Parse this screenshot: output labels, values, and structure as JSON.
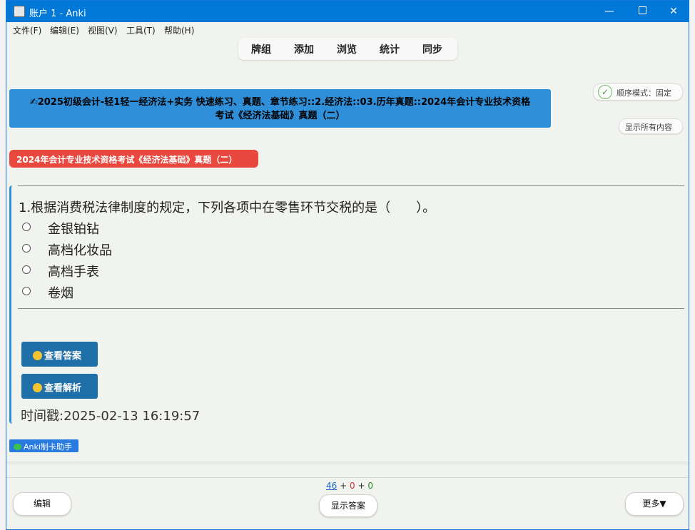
{
  "window": {
    "title": "账户 1 - Anki",
    "controls": [
      "minimize",
      "maximize",
      "close"
    ]
  },
  "menu": {
    "items": [
      "文件(F)",
      "编辑(E)",
      "视图(V)",
      "工具(T)",
      "帮助(H)"
    ]
  },
  "toolbar": {
    "items": [
      "牌组",
      "添加",
      "浏览",
      "统计",
      "同步"
    ]
  },
  "card": {
    "deck_path_line1": "✍2025初级会计-轻1轻一经济法+实务 快速练习、真题、章节练习::2.经济法::03.历年真题::2024年会计专业技术资格",
    "deck_path_line2": "考试《经济法基础》真题（二）",
    "mode_label": "顺序模式：固定",
    "show_all_label": "显示所有内容",
    "exam_tag": "2024年会计专业技术资格考试《经济法基础》真题（二）",
    "question": "1.根据消费税法律制度的规定，下列各项中在零售环节交税的是（　　）。",
    "options": [
      "金银铂钻",
      "高档化妆品",
      "高档手表",
      "卷烟"
    ],
    "view_answer_label": "查看答案",
    "view_analysis_label": "查看解析",
    "timestamp": "时间戳:2025-02-13 16:19:57",
    "badge": "Anki制卡助手"
  },
  "bottom": {
    "count_new": "46",
    "count_learn": "0",
    "count_review": "0",
    "plus": "+",
    "edit_label": "编辑",
    "show_answer_label": "显示答案",
    "more_label": "更多▼"
  },
  "colors": {
    "titlebar": "#0078d7",
    "deck_header": "#2f8fd8",
    "exam_tag": "#e8483e",
    "action_button": "#1f6fa9",
    "badge": "#2a7be0"
  }
}
